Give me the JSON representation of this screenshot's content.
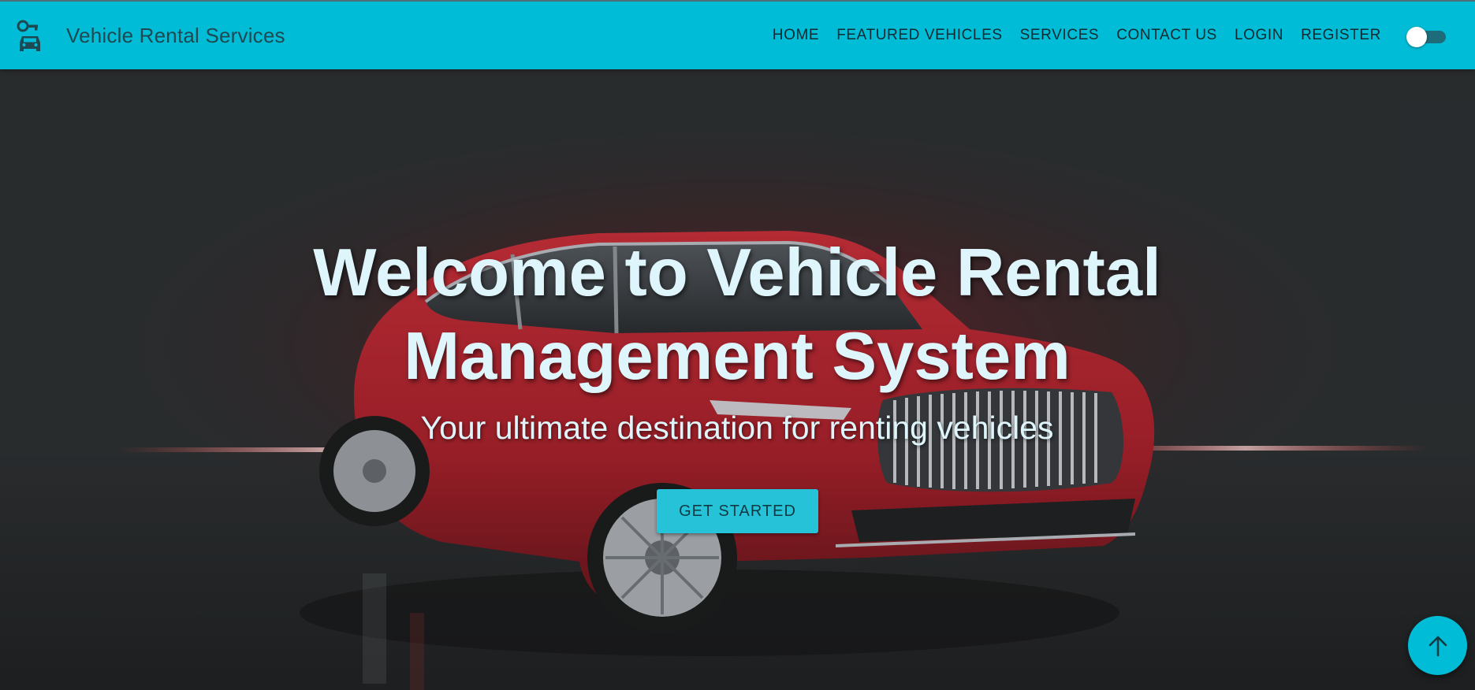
{
  "header": {
    "brand_title": "Vehicle Rental Services",
    "brand_icon": "car-key-icon",
    "nav": [
      {
        "label": "HOME"
      },
      {
        "label": "FEATURED VEHICLES"
      },
      {
        "label": "SERVICES"
      },
      {
        "label": "CONTACT US"
      },
      {
        "label": "LOGIN"
      },
      {
        "label": "REGISTER"
      }
    ],
    "theme_toggle": {
      "state": "off",
      "icon": "toggle-switch"
    }
  },
  "hero": {
    "title": "Welcome to Vehicle Rental Management System",
    "subtitle": "Your ultimate destination for renting vehicles",
    "cta_label": "GET STARTED",
    "background": "red luxury SUV"
  },
  "scroll_top": {
    "icon": "arrow-up-icon"
  },
  "colors": {
    "primary": "#00bcd6",
    "button": "#26c3d8",
    "hero_text": "#def6fb",
    "background": "#2e3133",
    "car_red": "#c21f2c"
  }
}
